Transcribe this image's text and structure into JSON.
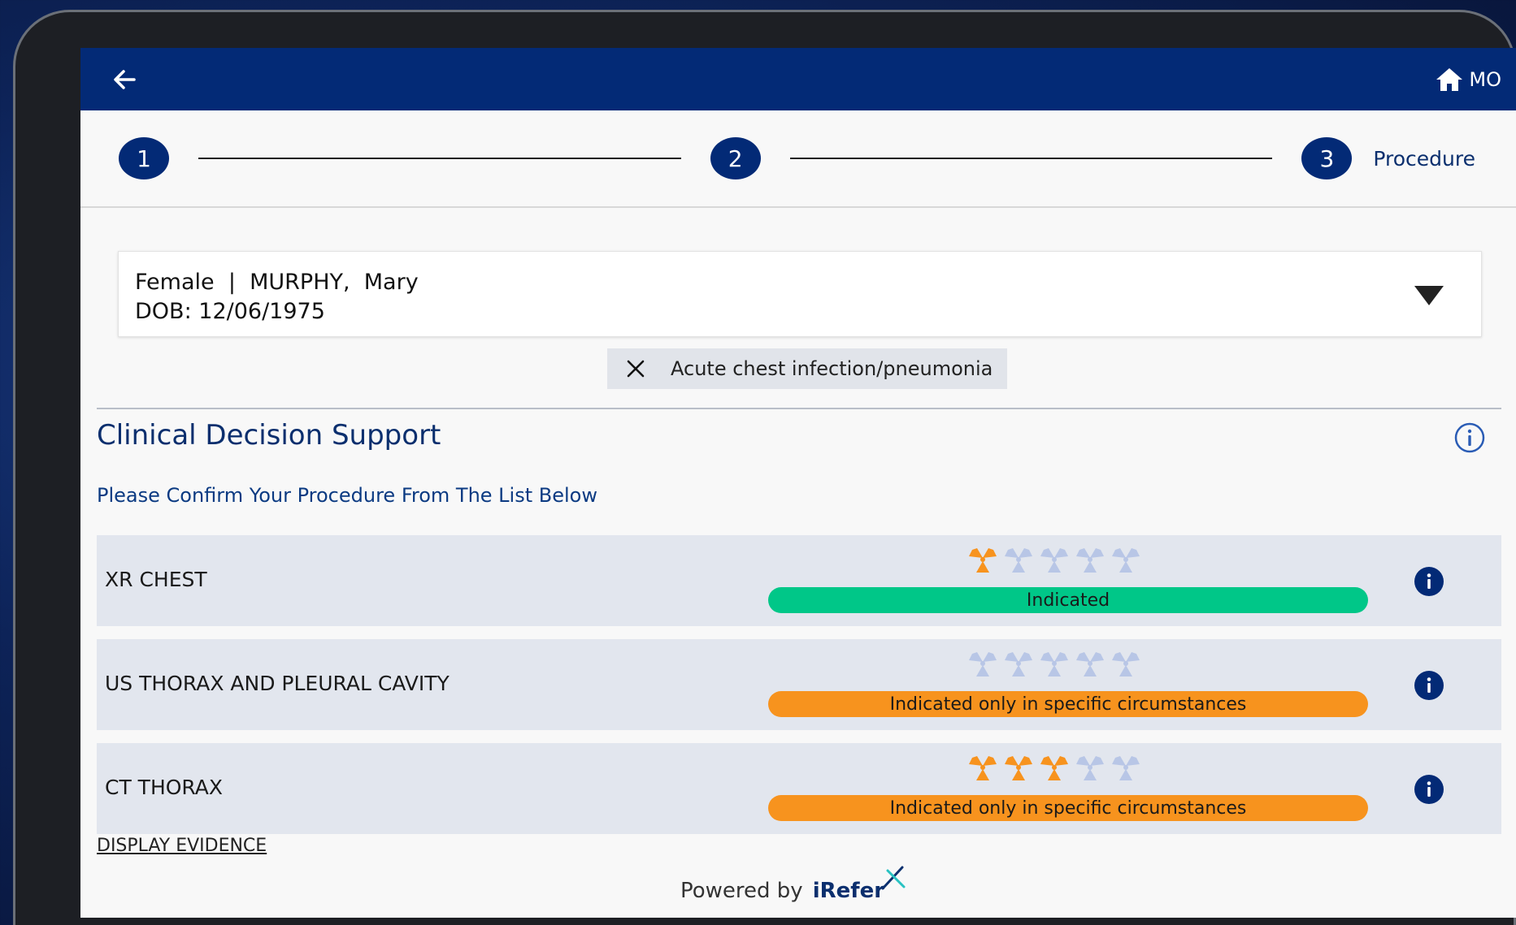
{
  "header": {
    "back_icon": "arrow-left-icon",
    "home_icon": "home-icon",
    "user_initials": "MO"
  },
  "stepper": {
    "steps": [
      {
        "number": "1",
        "label": ""
      },
      {
        "number": "2",
        "label": ""
      },
      {
        "number": "3",
        "label": "Procedure"
      }
    ]
  },
  "patient": {
    "gender": "Female",
    "separator": "|",
    "name": "MURPHY,  Mary",
    "dob_label": "DOB:",
    "dob": "12/06/1975"
  },
  "condition_chip": {
    "label": "Acute chest infection/pneumonia"
  },
  "cds": {
    "title": "Clinical Decision Support",
    "subtitle": "Please Confirm Your Procedure From The List Below"
  },
  "procedures": [
    {
      "name": "XR CHEST",
      "status": "Indicated",
      "status_color": "#00c788",
      "radiation_level": 1,
      "radiation_max": 5
    },
    {
      "name": "US THORAX AND PLEURAL CAVITY",
      "status": "Indicated only in specific circumstances",
      "status_color": "#f7931e",
      "radiation_level": 0,
      "radiation_max": 5
    },
    {
      "name": "CT THORAX",
      "status": "Indicated only in specific circumstances",
      "status_color": "#f7931e",
      "radiation_level": 3,
      "radiation_max": 5
    }
  ],
  "evidence_link": "DISPLAY EVIDENCE",
  "footer": {
    "powered_by": "Powered by",
    "brand": "iRefer"
  },
  "colors": {
    "primary": "#032a76",
    "radiation_active": "#f7931e",
    "radiation_inactive": "#b8c6e6"
  }
}
